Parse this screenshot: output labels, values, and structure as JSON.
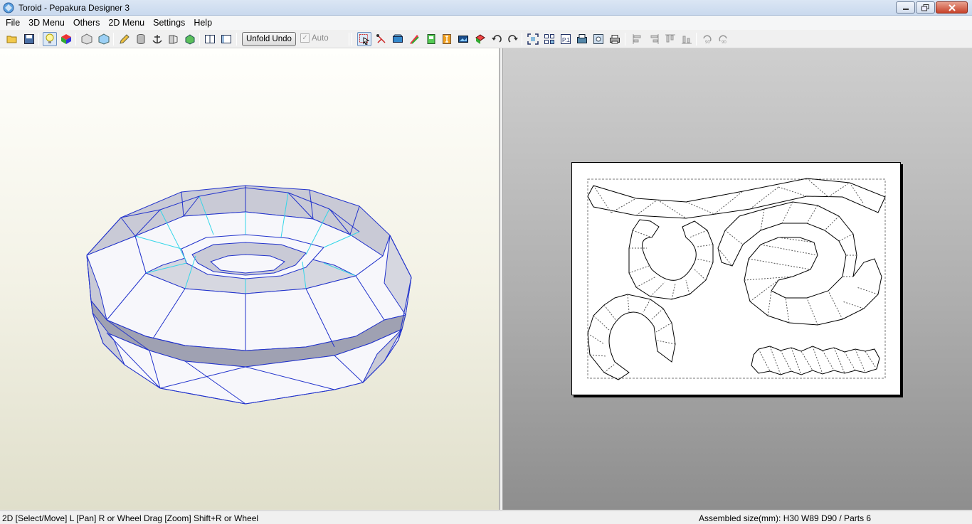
{
  "window": {
    "title": "Toroid - Pepakura Designer 3",
    "controls": [
      "minimize-icon",
      "restore-icon",
      "close-icon"
    ]
  },
  "menubar": {
    "items": [
      "File",
      "3D Menu",
      "Others",
      "2D Menu",
      "Settings",
      "Help"
    ]
  },
  "toolbar": {
    "unfold_undo_label": "Unfold Undo",
    "auto_label": "Auto",
    "auto_checked": true,
    "icons": [
      "open-icon",
      "save-icon",
      "light-icon",
      "color-cube-icon",
      "box-icon",
      "texture-box-icon",
      "pencil-icon",
      "cylinder-icon",
      "anchor-icon",
      "flap-icon",
      "join-icon",
      "single-pane-icon",
      "split-pane-icon",
      "select-icon",
      "edge-icon",
      "flap-tool-icon",
      "paint-icon",
      "text-icon",
      "image-icon",
      "move-part-icon",
      "rotate-left-icon",
      "rotate-right-icon",
      "fit-icon",
      "arrange-icon",
      "page-icon",
      "settings-icon",
      "print-preview-icon",
      "print-icon",
      "align-left-icon",
      "align-right-icon",
      "align-top-icon",
      "align-bottom-icon",
      "rotate-90-ccw-icon",
      "rotate-90-cw-icon"
    ]
  },
  "colors": {
    "mesh_edge": "#2233cc",
    "mesh_fold": "#33d6e8",
    "face_light": "#f7f7fb",
    "face_shade": "#c9cad6",
    "paper_border": "#000000"
  },
  "statusbar": {
    "left_text": "2D [Select/Move] L [Pan] R or Wheel Drag [Zoom] Shift+R or Wheel",
    "right_text": "Assembled size(mm): H30 W89 D90 / Parts 6"
  }
}
